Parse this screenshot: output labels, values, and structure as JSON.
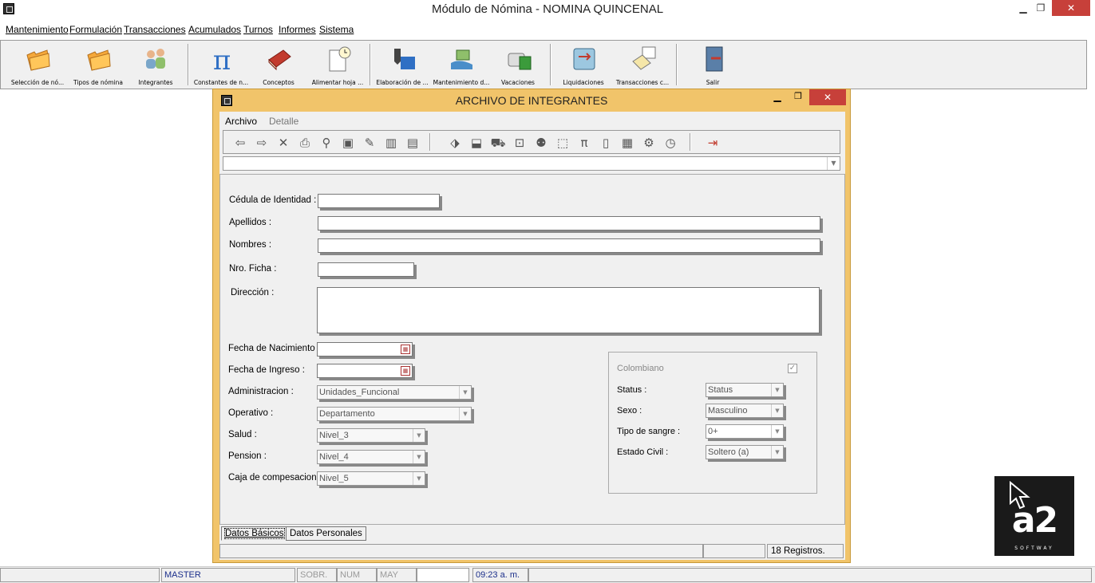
{
  "window": {
    "title": "Módulo de Nómina - NOMINA QUINCENAL",
    "close_glyph": "✕",
    "min_glyph": "▁",
    "max_glyph": "❐"
  },
  "menu": [
    "Mantenimiento",
    "Formulación",
    "Transacciones",
    "Acumulados",
    "Turnos",
    "Informes",
    "Sistema"
  ],
  "toolbar": [
    {
      "label": "Selección de nó...",
      "icon": "folder-icon"
    },
    {
      "label": "Tipos de nómina",
      "icon": "folder-icon"
    },
    {
      "label": "Integrantes",
      "icon": "users-icon"
    },
    {
      "label": "Constantes de n...",
      "icon": "pi-icon"
    },
    {
      "label": "Conceptos",
      "icon": "book-icon"
    },
    {
      "label": "Alimentar hoja ...",
      "icon": "clock-doc-icon"
    },
    {
      "label": "Elaboración de ...",
      "icon": "pen-icon"
    },
    {
      "label": "Mantenimiento d...",
      "icon": "money-hand-icon"
    },
    {
      "label": "Vacaciones",
      "icon": "car-icon"
    },
    {
      "label": "Liquidaciones",
      "icon": "transfer-icon"
    },
    {
      "label": "Transacciones c...",
      "icon": "calendar-icon"
    },
    {
      "label": "Salir",
      "icon": "exit-door-icon"
    }
  ],
  "child": {
    "title": "ARCHIVO DE INTEGRANTES",
    "menu": {
      "archivo": "Archivo",
      "detalle": "Detalle"
    },
    "form": {
      "cedula": {
        "label": "Cédula de Identidad :",
        "value": ""
      },
      "apellidos": {
        "label": "Apellidos :",
        "value": ""
      },
      "nombres": {
        "label": "Nombres :",
        "value": ""
      },
      "ficha": {
        "label": "Nro. Ficha :",
        "value": ""
      },
      "direccion": {
        "label": "Dirección :",
        "value": ""
      },
      "fecha_nac": {
        "label": "Fecha de Nacimiento :",
        "value": ""
      },
      "fecha_ing": {
        "label": "Fecha de Ingreso :",
        "value": ""
      },
      "administracion": {
        "label": "Administracion :",
        "value": "Unidades_Funcional"
      },
      "operativo": {
        "label": "Operativo :",
        "value": "Departamento"
      },
      "salud": {
        "label": "Salud :",
        "value": "Nivel_3"
      },
      "pension": {
        "label": "Pension :",
        "value": "Nivel_4"
      },
      "caja": {
        "label": "Caja de compesacion :",
        "value": "Nivel_5"
      }
    },
    "group": {
      "colombiano": {
        "label": "Colombiano",
        "checked": true
      },
      "status": {
        "label": "Status :",
        "value": "Status"
      },
      "sexo": {
        "label": "Sexo :",
        "value": "Masculino"
      },
      "sangre": {
        "label": "Tipo de sangre :",
        "value": "0+"
      },
      "civil": {
        "label": "Estado Civil :",
        "value": "Soltero (a)"
      }
    },
    "tabs": [
      "Datos Básicos",
      "Datos Personales"
    ],
    "status": {
      "registros": "18 Registros."
    }
  },
  "statusbar": {
    "user": "MASTER",
    "sobr": "SOBR.",
    "num": "NUM",
    "may": "MAY",
    "time": "09:23 a. m."
  },
  "logo": {
    "mark": "a2",
    "sub": "SOFTWAY"
  }
}
